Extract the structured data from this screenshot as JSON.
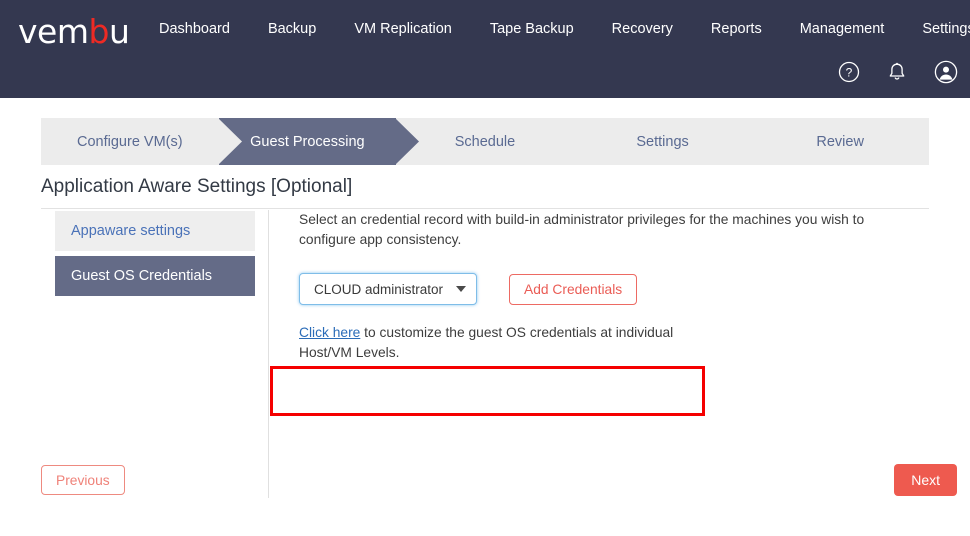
{
  "header": {
    "logo_text_main": "vem",
    "logo_text_highlight": "b",
    "logo_text_tail": "u",
    "logo_highlight_color": "#ee2a24",
    "background_color": "#343850",
    "nav_items": [
      {
        "label": "Dashboard"
      },
      {
        "label": "Backup"
      },
      {
        "label": "VM Replication"
      },
      {
        "label": "Tape Backup"
      },
      {
        "label": "Recovery"
      },
      {
        "label": "Reports"
      },
      {
        "label": "Management"
      },
      {
        "label": "Settings"
      }
    ],
    "icons": [
      {
        "name": "help-icon",
        "glyph": "?"
      },
      {
        "name": "notification-bell-icon",
        "glyph": "bell"
      },
      {
        "name": "user-avatar-icon",
        "glyph": "person"
      }
    ]
  },
  "wizard": {
    "steps": [
      {
        "label": "Configure VM(s)",
        "active": false
      },
      {
        "label": "Guest Processing",
        "active": true
      },
      {
        "label": "Schedule",
        "active": false
      },
      {
        "label": "Settings",
        "active": false
      },
      {
        "label": "Review",
        "active": false
      }
    ],
    "active_color": "#646b87",
    "inactive_color": "#ececec"
  },
  "page": {
    "title": "Application Aware Settings [Optional]"
  },
  "sidebar": {
    "items": [
      {
        "label": "Appaware settings",
        "active": false
      },
      {
        "label": "Guest OS Credentials",
        "active": true
      }
    ]
  },
  "main": {
    "description": "Select an credential record with build-in administrator privileges for the machines you wish to configure app consistency.",
    "credential_select": {
      "selected": "CLOUD administrator",
      "options": [
        "CLOUD administrator"
      ]
    },
    "add_credentials_label": "Add Credentials",
    "note_link_text": "Click here",
    "note_rest_text": " to customize the guest OS credentials at individual Host/VM Levels."
  },
  "footer": {
    "previous_label": "Previous",
    "next_label": "Next",
    "next_color": "#ee5a4f"
  },
  "annotation": {
    "color": "#f50000"
  }
}
